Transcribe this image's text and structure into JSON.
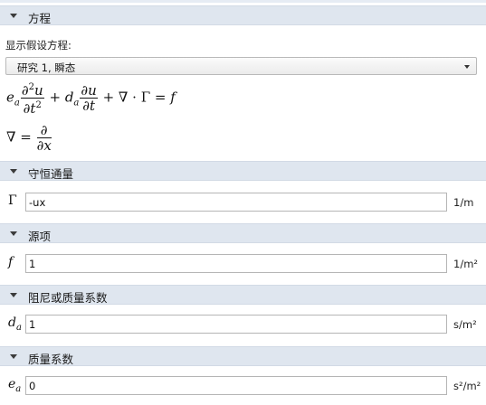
{
  "sections": {
    "equation": {
      "title": "方程"
    },
    "flux": {
      "title": "守恒通量"
    },
    "source": {
      "title": "源项"
    },
    "damping": {
      "title": "阻尼或质量系数"
    },
    "mass": {
      "title": "质量系数"
    }
  },
  "equation": {
    "show_label": "显示假设方程:",
    "study_selected": "研究 1, 瞬态",
    "pde": {
      "ea": "e",
      "ea_sub": "a",
      "d2u": "∂",
      "d2u_sup": "2",
      "d2u_u": "u",
      "dt2": "∂t",
      "dt2_sup": "2",
      "plus1": "+",
      "da": "d",
      "da_sub": "a",
      "du": "∂u",
      "dt": "∂t",
      "rest": "+ ∇ · Γ = ",
      "f": "f"
    },
    "nabla_def": {
      "lhs": "∇ = ",
      "num": "∂",
      "den": "∂x"
    }
  },
  "flux": {
    "symbol": "Γ",
    "value": "-ux",
    "unit": "1/m"
  },
  "source": {
    "symbol": "f",
    "value": "1",
    "unit": "1/m²"
  },
  "damping": {
    "symbol": "d",
    "symbol_sub": "a",
    "value": "1",
    "unit": "s/m²"
  },
  "mass": {
    "symbol": "e",
    "symbol_sub": "a",
    "value": "0",
    "unit": "s²/m²"
  }
}
